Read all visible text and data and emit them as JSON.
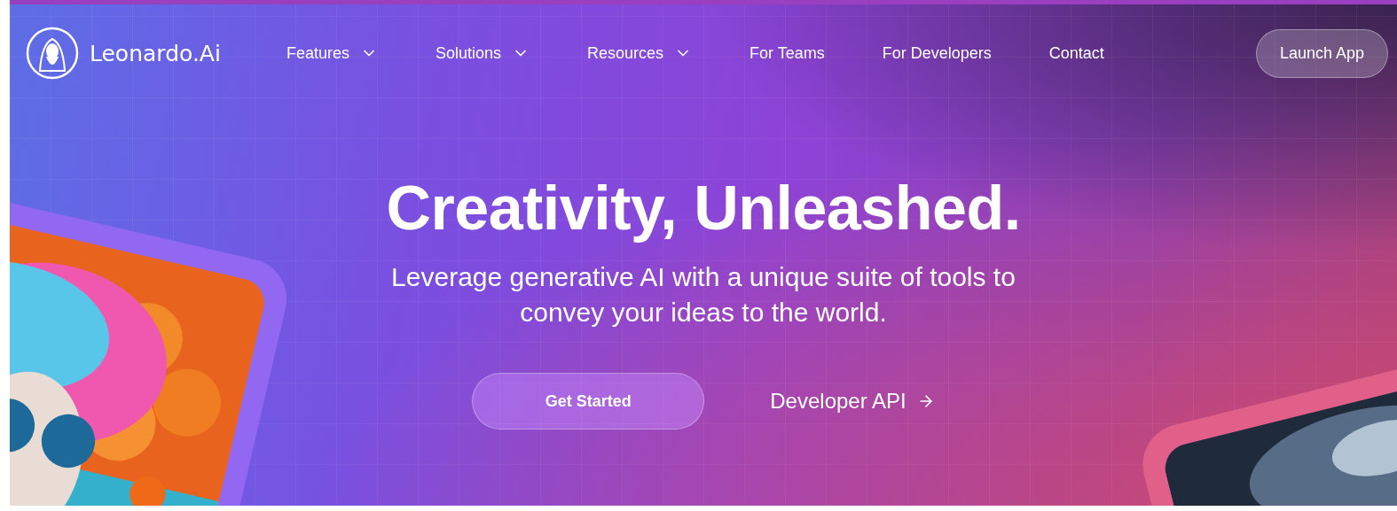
{
  "brand": {
    "name": "Leonardo.Ai"
  },
  "nav": {
    "items": [
      {
        "label": "Features",
        "kind": "dropdown"
      },
      {
        "label": "Solutions",
        "kind": "dropdown"
      },
      {
        "label": "Resources",
        "kind": "dropdown"
      },
      {
        "label": "For Teams",
        "kind": "link"
      },
      {
        "label": "For Developers",
        "kind": "link"
      },
      {
        "label": "Contact",
        "kind": "link"
      }
    ],
    "action": "Launch App"
  },
  "hero": {
    "headline": "Creativity, Unleashed.",
    "subtitle": "Leverage generative AI with a unique suite of tools to convey your ideas to the world.",
    "buttons": [
      {
        "label": "Get Started",
        "kind": "primary"
      },
      {
        "label": "Developer API",
        "kind": "arrow-link"
      }
    ]
  }
}
